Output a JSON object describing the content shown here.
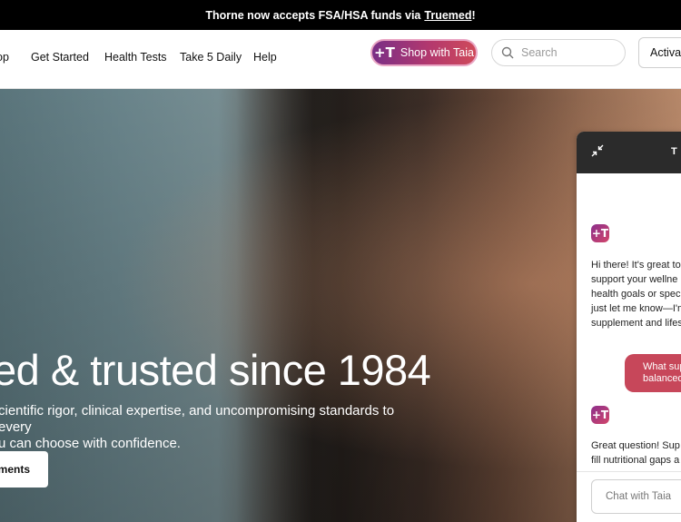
{
  "promo": {
    "text": "Thorne now accepts FSA/HSA funds via",
    "link": "Truemed",
    "suffix": "!"
  },
  "nav": {
    "items": [
      "op",
      "Get Started",
      "Health Tests",
      "Take 5 Daily",
      "Help"
    ],
    "shop_label": "Shop with Taia",
    "search_placeholder": "Search",
    "activate_label": "Activat"
  },
  "hero": {
    "title": "ed & trusted since 1984",
    "subtitle_line1": "cientific rigor, clinical expertise, and uncompromising standards to every",
    "subtitle_line2": "u can choose with confidence.",
    "cta_label": "ements"
  },
  "chat": {
    "brand": "T",
    "messages": [
      [
        "Hi there! It's great to",
        "support your wellne",
        "health goals or spec",
        "just let me know—I'm",
        "supplement and lifes"
      ],
      [
        "Great question! Sup",
        "fill nutritional gaps a"
      ]
    ],
    "user_message_line1": "What sup",
    "user_message_line2": "balanced",
    "input_placeholder": "Chat with Taia"
  }
}
